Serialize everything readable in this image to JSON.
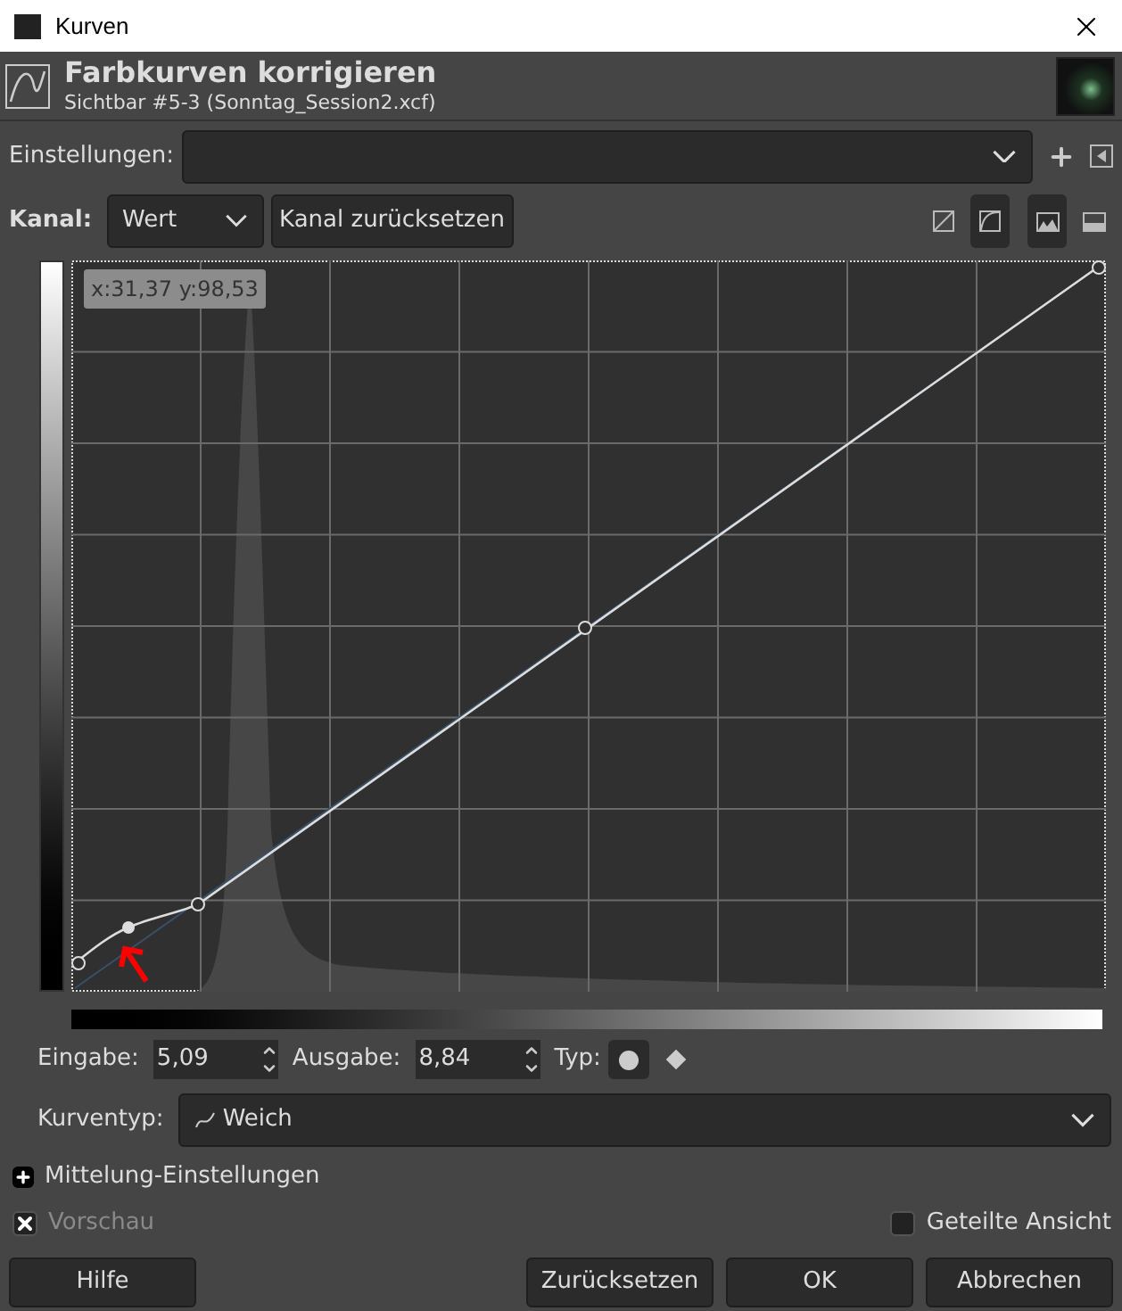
{
  "window": {
    "title": "Kurven"
  },
  "header": {
    "title": "Farbkurven korrigieren",
    "subtitle": "Sichtbar #5-3 (Sonntag_Session2.xcf)"
  },
  "settings": {
    "label": "Einstellungen:"
  },
  "channel": {
    "label": "Kanal:",
    "value": "Wert",
    "reset": "Kanal zurücksetzen"
  },
  "histogram_scale": [
    {
      "kind": "linear",
      "selected": false
    },
    {
      "kind": "log",
      "selected": true
    }
  ],
  "curve_view": [
    {
      "kind": "behind",
      "selected": true
    },
    {
      "kind": "front",
      "selected": false
    }
  ],
  "graph": {
    "coordinates": "x:31,37 y:98,53"
  },
  "point": {
    "input_label": "Eingabe:",
    "input": "5,09",
    "output_label": "Ausgabe:",
    "output": "8,84",
    "type_label": "Typ:",
    "types": [
      {
        "kind": "smooth",
        "selected": true
      },
      {
        "kind": "corner",
        "selected": false
      }
    ]
  },
  "curve_type": {
    "label": "Kurventyp:",
    "value": "Weich"
  },
  "averaging": {
    "label": "Mittelung-Einstellungen",
    "expanded": false
  },
  "preview": {
    "label": "Vorschau",
    "checked": true,
    "disabled": true
  },
  "split_view": {
    "label": "Geteilte Ansicht",
    "checked": false
  },
  "buttons": [
    "Hilfe",
    "Zurücksetzen",
    "OK",
    "Abbrechen"
  ]
}
